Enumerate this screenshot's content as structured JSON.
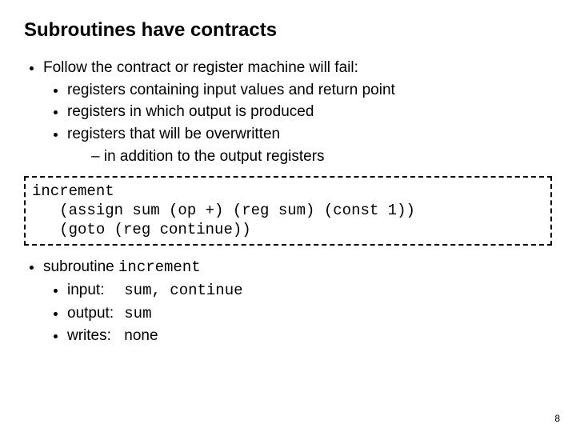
{
  "title": "Subroutines have contracts",
  "list1": {
    "root": "Follow the contract or register machine will fail:",
    "items": [
      "registers containing input values and return point",
      "registers in which output is produced",
      "registers that will be overwritten"
    ],
    "subsub": "in addition to the output registers"
  },
  "code": "increment\n   (assign sum (op +) (reg sum) (const 1))\n   (goto (reg continue))",
  "list2": {
    "prefix": "subroutine ",
    "name": "increment",
    "rows": [
      {
        "label": "input:",
        "value": "sum, continue"
      },
      {
        "label": "output:",
        "value": "sum"
      },
      {
        "label": "writes:",
        "value": "none",
        "mono": false
      }
    ]
  },
  "pagenum": "8"
}
